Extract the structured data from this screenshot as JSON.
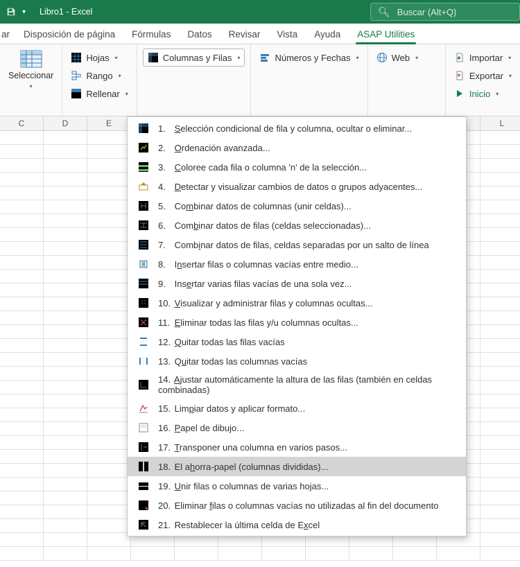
{
  "titlebar": {
    "title": "Libro1 - Excel",
    "search_placeholder": "Buscar (Alt+Q)"
  },
  "tabs": [
    "ar",
    "Disposición de página",
    "Fórmulas",
    "Datos",
    "Revisar",
    "Vista",
    "Ayuda",
    "ASAP Utilities"
  ],
  "active_tab_index": 7,
  "ribbon": {
    "select": {
      "label": "Seleccionar"
    },
    "group2": {
      "hojas": "Hojas",
      "rango": "Rango",
      "rellenar": "Rellenar"
    },
    "colfilas": "Columnas y Filas",
    "numeros": "Números y Fechas",
    "web": "Web",
    "right": {
      "importar": "Importar",
      "exportar": "Exportar",
      "inicio": "Inicio"
    }
  },
  "columns": [
    "C",
    "D",
    "E",
    "",
    "",
    "",
    "",
    "",
    "",
    "",
    "",
    "L"
  ],
  "menu": [
    {
      "n": "1.",
      "u": "S",
      "rest": "elección condicional de fila y columna, ocultar o eliminar..."
    },
    {
      "n": "2.",
      "u": "O",
      "rest": "rdenación avanzada..."
    },
    {
      "n": "3.",
      "u": "C",
      "rest": "oloree cada fila o columna 'n' de la selección..."
    },
    {
      "n": "4.",
      "u": "D",
      "rest": "etectar y visualizar cambios de datos o grupos adyacentes..."
    },
    {
      "n": "5.",
      "u": "",
      "pre": "Co",
      "u2": "m",
      "rest": "binar datos de columnas (unir celdas)..."
    },
    {
      "n": "6.",
      "u": "",
      "pre": "Com",
      "u2": "b",
      "rest": "inar datos de filas (celdas seleccionadas)..."
    },
    {
      "n": "7.",
      "u": "",
      "pre": "Comb",
      "u2": "i",
      "rest": "nar datos de filas, celdas separadas por un salto de línea"
    },
    {
      "n": "8.",
      "u": "",
      "pre": "I",
      "u2": "n",
      "rest": "sertar filas o columnas vacías entre medio..."
    },
    {
      "n": "9.",
      "u": "",
      "pre": "Ins",
      "u2": "e",
      "rest": "rtar varias filas vacías de una sola vez..."
    },
    {
      "n": "10.",
      "u": "V",
      "rest": "isualizar y administrar filas y columnas ocultas..."
    },
    {
      "n": "11.",
      "u": "E",
      "rest": "liminar todas las filas y/u columnas ocultas..."
    },
    {
      "n": "12.",
      "u": "Q",
      "rest": "uitar todas las filas vacías"
    },
    {
      "n": "13.",
      "u": "",
      "pre": "Q",
      "u2": "u",
      "rest": "itar todas las columnas vacías"
    },
    {
      "n": "14.",
      "u": "A",
      "rest": "justar automáticamente la altura de las filas (también en celdas combinadas)"
    },
    {
      "n": "15.",
      "u": "",
      "pre": "Lim",
      "u2": "p",
      "rest": "iar datos y aplicar formato..."
    },
    {
      "n": "16.",
      "u": "P",
      "rest": "apel de dibujo..."
    },
    {
      "n": "17.",
      "u": "T",
      "rest": "ransponer una columna en varios pasos..."
    },
    {
      "n": "18.",
      "u": "",
      "pre": "El a",
      "u2": "h",
      "rest": "orra-papel (columnas divididas)...",
      "hover": true
    },
    {
      "n": "19.",
      "u": "U",
      "rest": "nir filas o columnas de varias hojas..."
    },
    {
      "n": "20.",
      "u": "",
      "pre": "Eliminar ",
      "u2": "f",
      "rest": "ilas o columnas vacías no utilizadas al fin del documento"
    },
    {
      "n": "21.",
      "u": "",
      "pre": "Restablecer la última celda de E",
      "u2": "x",
      "rest": "cel"
    }
  ]
}
